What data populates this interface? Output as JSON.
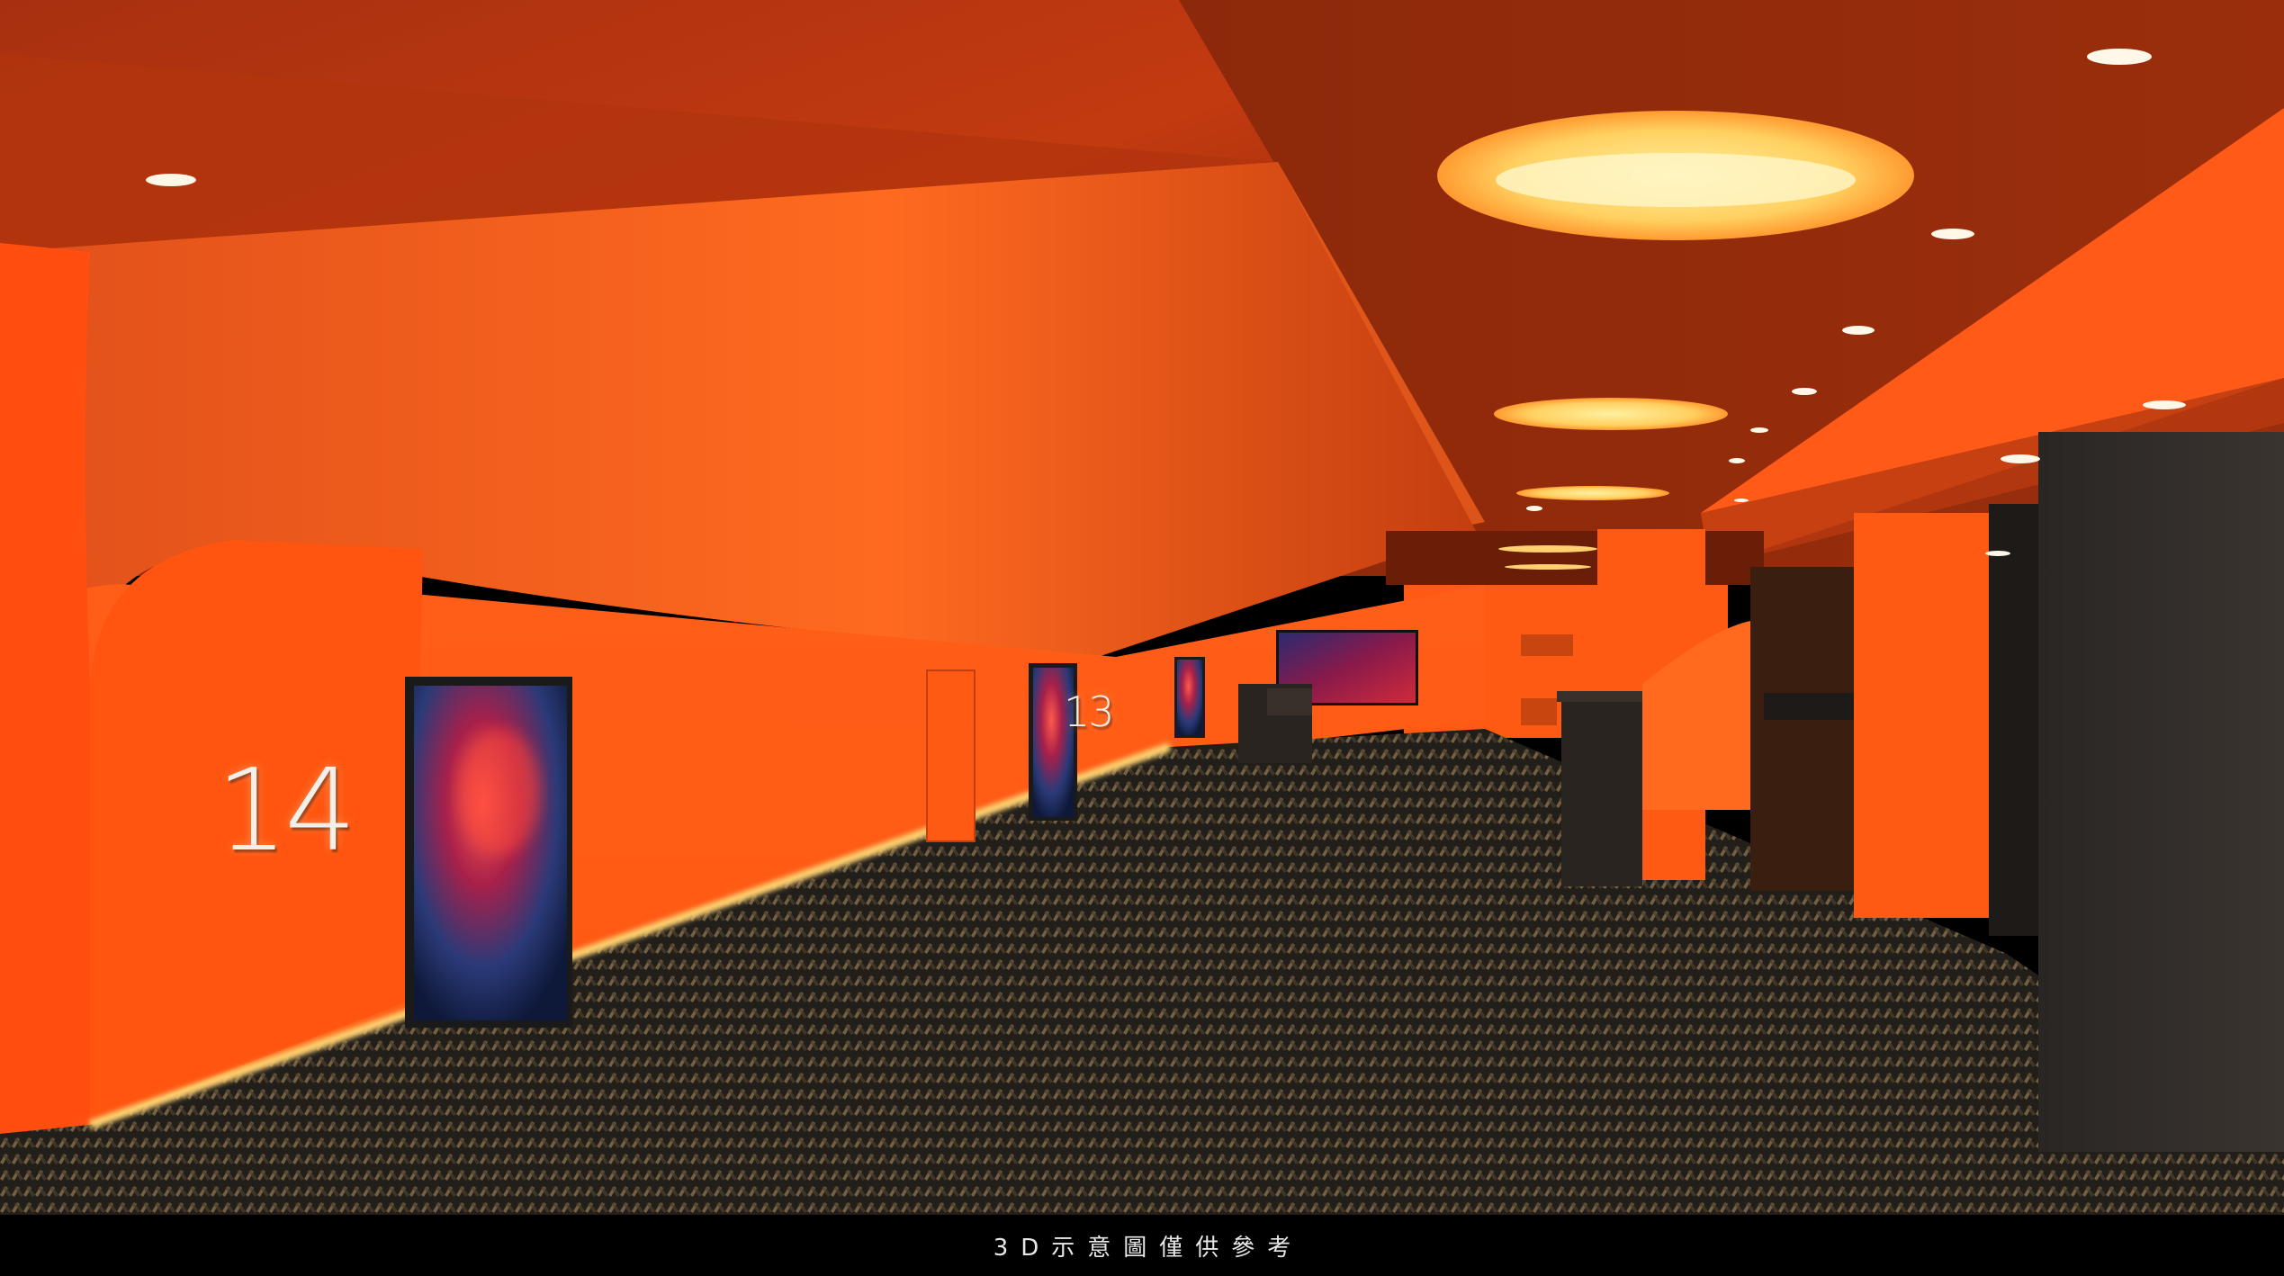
{
  "scene": {
    "description_free": true,
    "theatre_numbers": [
      "14",
      "13"
    ],
    "caption": "3D示意圖僅供參考",
    "colors": {
      "wall_orange": "#ff5a14",
      "ceiling_dark": "#8a2608",
      "ceiling_light": "#d04010",
      "carpet_dark": "#2a2520",
      "carpet_light": "#8a7350",
      "cove_glow": "#ffb040",
      "dark_wall": "#2c2a28",
      "caption_bar": "#000000"
    }
  }
}
